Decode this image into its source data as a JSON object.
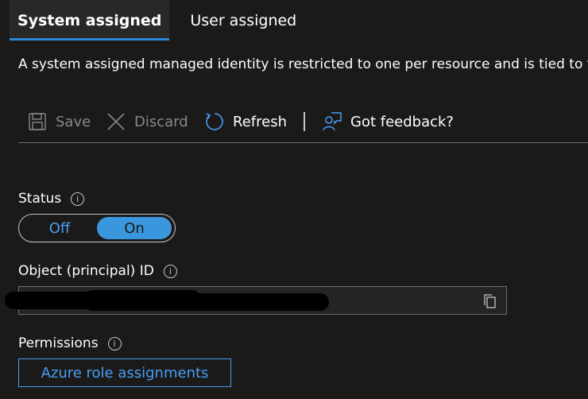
{
  "tabs": [
    {
      "label": "System assigned",
      "active": true
    },
    {
      "label": "User assigned",
      "active": false
    }
  ],
  "description": "A system assigned managed identity is restricted to one per resource and is tied to t",
  "toolbar": {
    "save_label": "Save",
    "discard_label": "Discard",
    "refresh_label": "Refresh",
    "feedback_label": "Got feedback?",
    "save_icon": "save-icon",
    "discard_icon": "close-icon",
    "refresh_icon": "refresh-icon",
    "feedback_icon": "feedback-icon"
  },
  "status": {
    "label": "Status",
    "options": [
      "Off",
      "On"
    ],
    "selected": "On"
  },
  "object_id": {
    "label": "Object (principal) ID",
    "value": ""
  },
  "permissions": {
    "label": "Permissions",
    "button_label": "Azure role assignments"
  },
  "colors": {
    "background": "#1b1a19",
    "accent": "#479ef5",
    "toggle_on": "#3a96dd",
    "disabled_text": "#8a8886"
  }
}
